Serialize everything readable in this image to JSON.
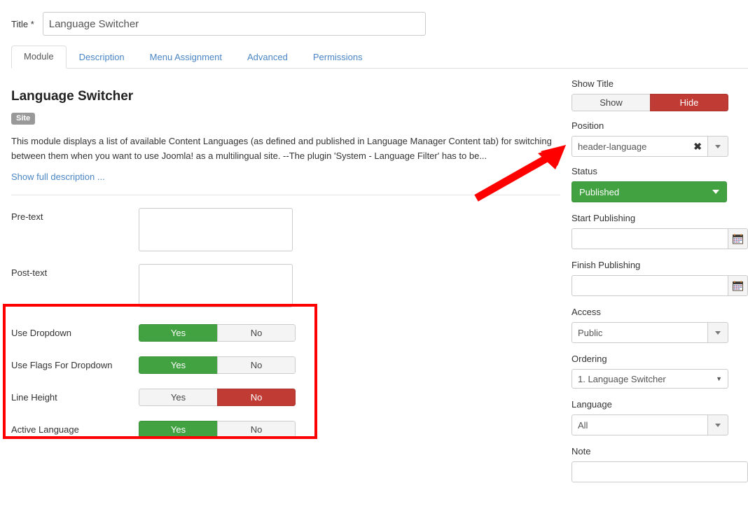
{
  "colors": {
    "green": "#42a242",
    "red": "#bf3b33",
    "annotation_red": "#fe0000",
    "link_blue": "#4a86c5",
    "badge_grey": "#999999"
  },
  "title_field": {
    "label": "Title *",
    "value": "Language Switcher",
    "placeholder": ""
  },
  "tabs": [
    {
      "label": "Module",
      "active": true
    },
    {
      "label": "Description",
      "active": false
    },
    {
      "label": "Menu Assignment",
      "active": false
    },
    {
      "label": "Advanced",
      "active": false
    },
    {
      "label": "Permissions",
      "active": false
    }
  ],
  "module_info": {
    "heading": "Language Switcher",
    "badge": "Site",
    "description": "This module displays a list of available Content Languages (as defined and published in Language Manager Content tab) for switching between them when you want to use Joomla! as a multilingual site. --The plugin 'System - Language Filter' has to be...",
    "show_full_link": "Show full description ..."
  },
  "text_fields": [
    {
      "label": "Pre-text",
      "value": "",
      "placeholder": ""
    },
    {
      "label": "Post-text",
      "value": "",
      "placeholder": ""
    }
  ],
  "toggles": [
    {
      "label": "Use Dropdown",
      "yes": "Yes",
      "no": "No",
      "selected": "yes"
    },
    {
      "label": "Use Flags For Dropdown",
      "yes": "Yes",
      "no": "No",
      "selected": "yes"
    },
    {
      "label": "Line Height",
      "yes": "Yes",
      "no": "No",
      "selected": "no"
    },
    {
      "label": "Active Language",
      "yes": "Yes",
      "no": "No",
      "selected": "yes"
    }
  ],
  "sidebar": {
    "show_title": {
      "label": "Show Title",
      "show": "Show",
      "hide": "Hide",
      "selected": "hide"
    },
    "position": {
      "label": "Position",
      "value": "header-language",
      "clear_icon": "✖"
    },
    "status": {
      "label": "Status",
      "value": "Published"
    },
    "start_publishing": {
      "label": "Start Publishing",
      "value": "",
      "placeholder": ""
    },
    "finish_publishing": {
      "label": "Finish Publishing",
      "value": "",
      "placeholder": ""
    },
    "access": {
      "label": "Access",
      "value": "Public"
    },
    "ordering": {
      "label": "Ordering",
      "value": "1. Language Switcher",
      "caret": "▼"
    },
    "language": {
      "label": "Language",
      "value": "All"
    },
    "note": {
      "label": "Note",
      "value": "",
      "placeholder": ""
    }
  },
  "annotations": {
    "arrow": {
      "name": "red-arrow-pointing-to-position-field"
    },
    "box": {
      "name": "red-highlight-box-around-dropdown-options"
    }
  }
}
